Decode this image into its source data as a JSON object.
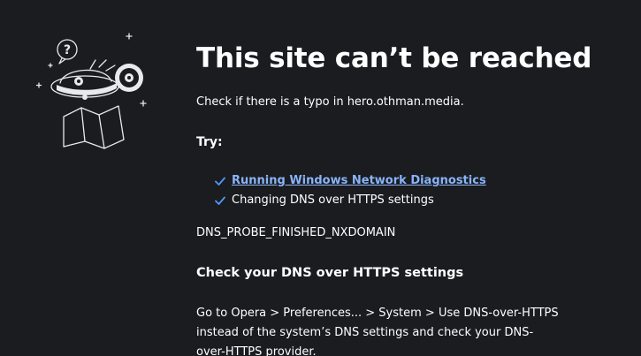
{
  "error": {
    "title": "This site can’t be reached",
    "subtitle": "Check if there is a typo in hero.othman.media.",
    "try_heading": "Try:",
    "suggestions": [
      {
        "label": "Running Windows Network Diagnostics",
        "is_link": true
      },
      {
        "label": "Changing DNS over HTTPS settings",
        "is_link": false
      }
    ],
    "code": "DNS_PROBE_FINISHED_NXDOMAIN",
    "dns_heading": "Check your DNS over HTTPS settings",
    "dns_body": "Go to Opera > Preferences... > System > Use DNS-over-HTTPS instead of the system’s DNS settings and check your DNS-over-HTTPS provider."
  },
  "colors": {
    "background": "#1a1c20",
    "text": "#ffffff",
    "link": "#8ab4f8",
    "check": "#4c9aff"
  },
  "icons": {
    "illustration": "lost-explorer-illustration",
    "check": "check-icon"
  }
}
